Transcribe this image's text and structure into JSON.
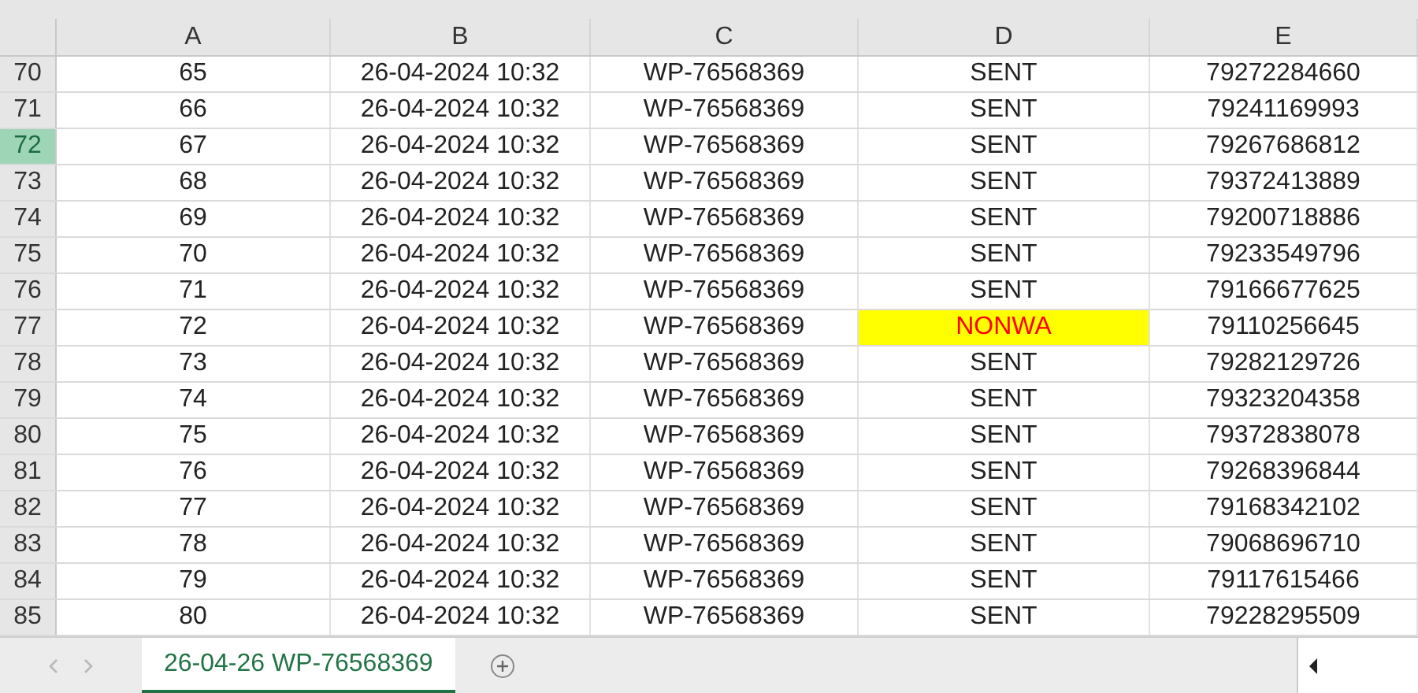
{
  "columns": [
    "A",
    "B",
    "C",
    "D",
    "E"
  ],
  "rows": [
    {
      "row": "70",
      "cells": [
        "65",
        "26-04-2024 10:32",
        "WP-76568369",
        "SENT",
        "79272284660"
      ],
      "selected": false,
      "flagged": false
    },
    {
      "row": "71",
      "cells": [
        "66",
        "26-04-2024 10:32",
        "WP-76568369",
        "SENT",
        "79241169993"
      ],
      "selected": false,
      "flagged": false
    },
    {
      "row": "72",
      "cells": [
        "67",
        "26-04-2024 10:32",
        "WP-76568369",
        "SENT",
        "79267686812"
      ],
      "selected": true,
      "flagged": false
    },
    {
      "row": "73",
      "cells": [
        "68",
        "26-04-2024 10:32",
        "WP-76568369",
        "SENT",
        "79372413889"
      ],
      "selected": false,
      "flagged": false
    },
    {
      "row": "74",
      "cells": [
        "69",
        "26-04-2024 10:32",
        "WP-76568369",
        "SENT",
        "79200718886"
      ],
      "selected": false,
      "flagged": false
    },
    {
      "row": "75",
      "cells": [
        "70",
        "26-04-2024 10:32",
        "WP-76568369",
        "SENT",
        "79233549796"
      ],
      "selected": false,
      "flagged": false
    },
    {
      "row": "76",
      "cells": [
        "71",
        "26-04-2024 10:32",
        "WP-76568369",
        "SENT",
        "79166677625"
      ],
      "selected": false,
      "flagged": false
    },
    {
      "row": "77",
      "cells": [
        "72",
        "26-04-2024 10:32",
        "WP-76568369",
        "NONWA",
        "79110256645"
      ],
      "selected": false,
      "flagged": true
    },
    {
      "row": "78",
      "cells": [
        "73",
        "26-04-2024 10:32",
        "WP-76568369",
        "SENT",
        "79282129726"
      ],
      "selected": false,
      "flagged": false
    },
    {
      "row": "79",
      "cells": [
        "74",
        "26-04-2024 10:32",
        "WP-76568369",
        "SENT",
        "79323204358"
      ],
      "selected": false,
      "flagged": false
    },
    {
      "row": "80",
      "cells": [
        "75",
        "26-04-2024 10:32",
        "WP-76568369",
        "SENT",
        "79372838078"
      ],
      "selected": false,
      "flagged": false
    },
    {
      "row": "81",
      "cells": [
        "76",
        "26-04-2024 10:32",
        "WP-76568369",
        "SENT",
        "79268396844"
      ],
      "selected": false,
      "flagged": false
    },
    {
      "row": "82",
      "cells": [
        "77",
        "26-04-2024 10:32",
        "WP-76568369",
        "SENT",
        "79168342102"
      ],
      "selected": false,
      "flagged": false
    },
    {
      "row": "83",
      "cells": [
        "78",
        "26-04-2024 10:32",
        "WP-76568369",
        "SENT",
        "79068696710"
      ],
      "selected": false,
      "flagged": false
    },
    {
      "row": "84",
      "cells": [
        "79",
        "26-04-2024 10:32",
        "WP-76568369",
        "SENT",
        "79117615466"
      ],
      "selected": false,
      "flagged": false
    },
    {
      "row": "85",
      "cells": [
        "80",
        "26-04-2024 10:32",
        "WP-76568369",
        "SENT",
        "79228295509"
      ],
      "selected": false,
      "flagged": false
    }
  ],
  "sheet_tabs": [
    {
      "label": "26-04-26 WP-76568369",
      "selected": true
    }
  ]
}
